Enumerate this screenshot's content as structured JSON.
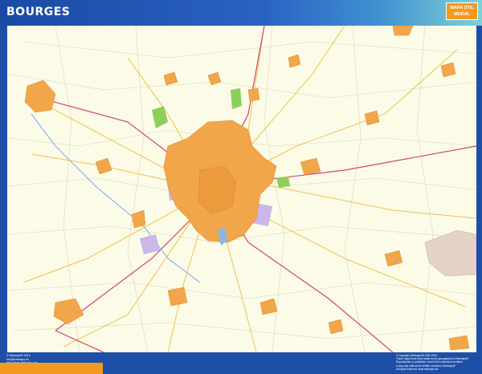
{
  "header": {
    "title": "BOURGES",
    "badge_line1": "MAPA ÚTIL",
    "badge_line2": "MURAL"
  },
  "footer": {
    "left_lines": [
      "© Netmaps® 2013",
      "info@netmaps.es",
      "http://www.netmaps.com"
    ],
    "right_lines": [
      "© Copyright (Netmaps®) 1992-2013",
      "These maps have been made by the geographers of Netmaps®",
      "Reproduction is prohibited, even if the contents is modified",
      "in any way, without the written consent of Netmaps®",
      "All rights reserved. www.netmaps.net"
    ]
  },
  "map": {
    "city": "Bourges",
    "colors": {
      "background": "#fbfbe8",
      "urban": "#f2a64a",
      "urban_outline": "#e08a2a",
      "parks": "#8ccf5a",
      "industrial": "#c9b8e8",
      "water": "#8ab7e6",
      "main_road": "#d2466a",
      "secondary_road": "#f0c24a",
      "minor_road": "#cfcfb8",
      "frame": "#1e4fa8",
      "accent": "#f39a1e"
    },
    "icons": [
      "road-network",
      "town-patch",
      "park-area",
      "river"
    ]
  }
}
